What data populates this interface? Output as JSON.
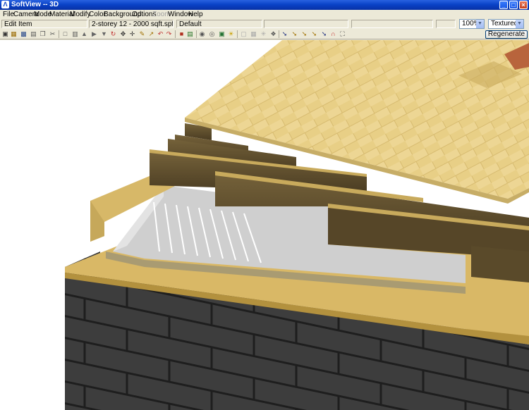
{
  "window": {
    "title": "SoftView -- 3D",
    "app_icon": "softview-app-icon"
  },
  "menu": [
    "File",
    "Camera",
    "Mode",
    "Material",
    "Modify",
    "Color",
    "Background",
    "Options",
    "Zoom",
    "Window",
    "Help"
  ],
  "menu_disabled": [
    "Zoom"
  ],
  "status": {
    "mode": "Edit Item",
    "file": "2-storey 12 - 2000 sqft.spf",
    "layer": "Default"
  },
  "zoom": {
    "value": "100%"
  },
  "render_mode": {
    "value": "Textured"
  },
  "toolbar": {
    "regenerate_label": "Regenerate",
    "icons": [
      "new-icon",
      "open-icon",
      "save-icon",
      "print-icon",
      "copy-icon",
      "cut-icon",
      "paste-icon",
      "select-icon",
      "view-front-icon",
      "view-side-icon",
      "view-top-icon",
      "rotate-icon",
      "pan-icon",
      "move-icon",
      "edit-icon",
      "scale-icon",
      "undo-icon",
      "redo-icon",
      "material-icon",
      "image-icon",
      "group-icon",
      "ungroup-icon",
      "zoom-window-icon",
      "light-icon",
      "layer-off-icon",
      "grid-off-icon",
      "snap-off-icon",
      "snap-on-icon",
      "wall-tool-icon",
      "roof-tool-icon",
      "floor-tool-icon",
      "stair-tool-icon",
      "dimension-tool-icon",
      "magnet-icon",
      "fit-window-icon"
    ]
  },
  "colors": {
    "titlebar": "#0a43c8",
    "roof_sheathing": "#e8cf86",
    "joist": "#5a4a2a",
    "concrete_block": "#3c3c3c",
    "top_plate": "#d9b866"
  }
}
